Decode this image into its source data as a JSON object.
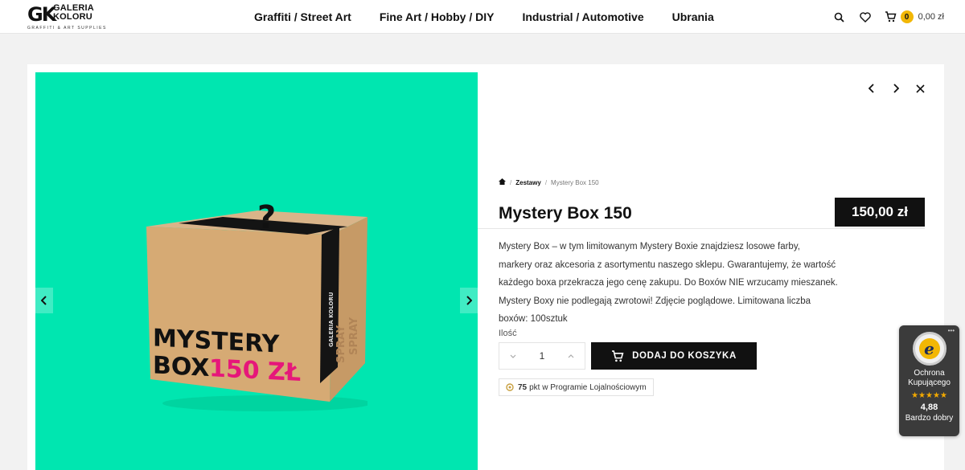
{
  "header": {
    "logo_mark": "GK",
    "logo_word_1": "GALERIA",
    "logo_word_2": "KOLORU",
    "logo_sub": "GRAFFITI & ART SUPPLIES",
    "nav": [
      {
        "label": "Graffiti / Street Art"
      },
      {
        "label": "Fine Art / Hobby / DIY"
      },
      {
        "label": "Industrial / Automotive"
      },
      {
        "label": "Ubrania"
      }
    ],
    "icons": [
      "search-icon",
      "heart-icon",
      "cart-icon"
    ],
    "cart_count": "0",
    "cart_total": "0,00 zł"
  },
  "product": {
    "breadcrumb": {
      "home_icon": "home-icon",
      "category": "Zestawy",
      "current": "Mystery Box 150"
    },
    "title": "Mystery Box 150",
    "price": "150,00 zł",
    "description_lines": [
      "Mystery Box – w tym limitowanym Mystery Boxie znajdziesz losowe farby,",
      "markery oraz akcesoria z asortymentu naszego sklepu. Gwarantujemy, że wartość",
      "każdego boxa przekracza jego cenę zakupu. Do Boxów NIE wrzucamy mieszanek.",
      "Mystery Boxy nie podlegają zwrotowi! Zdjęcie poglądowe. Limitowana liczba",
      "boxów: 100sztuk"
    ],
    "qty_label": "Ilość",
    "qty_value": "1",
    "add_to_cart": "DODAJ DO KOSZYKA",
    "loyalty_points": "75",
    "loyalty_text": "pkt w Programie Lojalnościowym",
    "image": {
      "box_text_line1": "MYSTERY",
      "box_text_line2_left": "BOX",
      "box_text_line2_accent": "150 ZŁ",
      "box_side_text": "SPRAY",
      "box_top_symbol": "?",
      "tape_text": "GALERIA KOLORU",
      "background_color": "#00e6b0",
      "accent_color": "#e6177a"
    }
  },
  "modal_controls": [
    "chevron-left-icon",
    "chevron-right-icon",
    "close-icon"
  ],
  "gallery_arrows": [
    "chevron-left-icon",
    "chevron-right-icon"
  ],
  "trusted_badge": {
    "seal_letter": "e",
    "title_1": "Ochrona",
    "title_2": "Kupującego",
    "stars": "★★★★★",
    "score": "4,88",
    "label": "Bardzo dobry",
    "menu": "•••"
  }
}
